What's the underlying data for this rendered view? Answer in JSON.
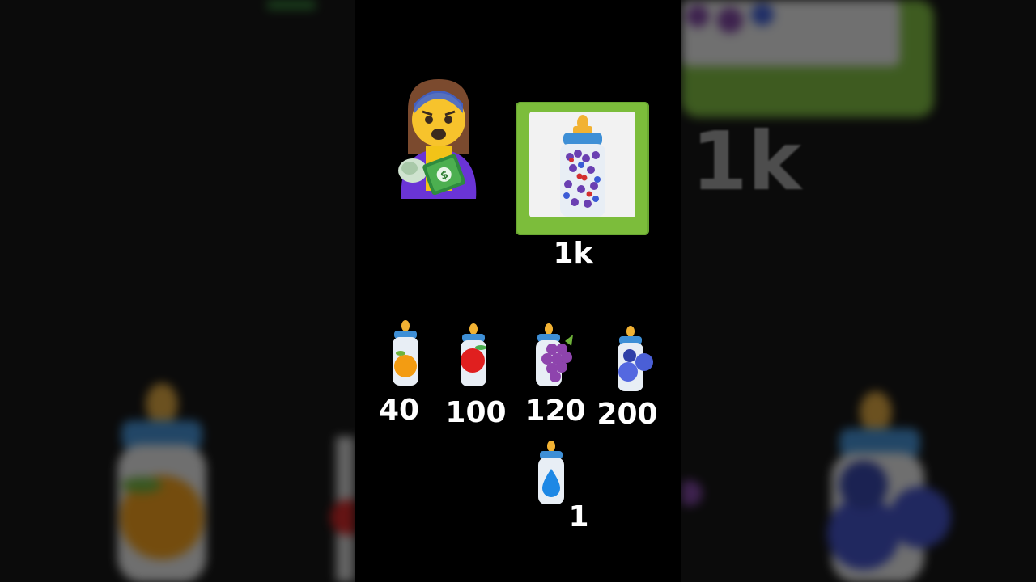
{
  "main": {
    "featured": {
      "price": "1k"
    },
    "items": [
      {
        "fruit": "orange",
        "price": "40"
      },
      {
        "fruit": "apple",
        "price": "100"
      },
      {
        "fruit": "grapes",
        "price": "120"
      },
      {
        "fruit": "blueberries",
        "price": "200"
      }
    ],
    "water": {
      "price": "1"
    }
  },
  "background": {
    "right_label": "1k"
  },
  "colors": {
    "frame_green": "#7cbd3b",
    "bottle_cap": "#f2b233",
    "bottle_ring": "#3e8fd6"
  }
}
